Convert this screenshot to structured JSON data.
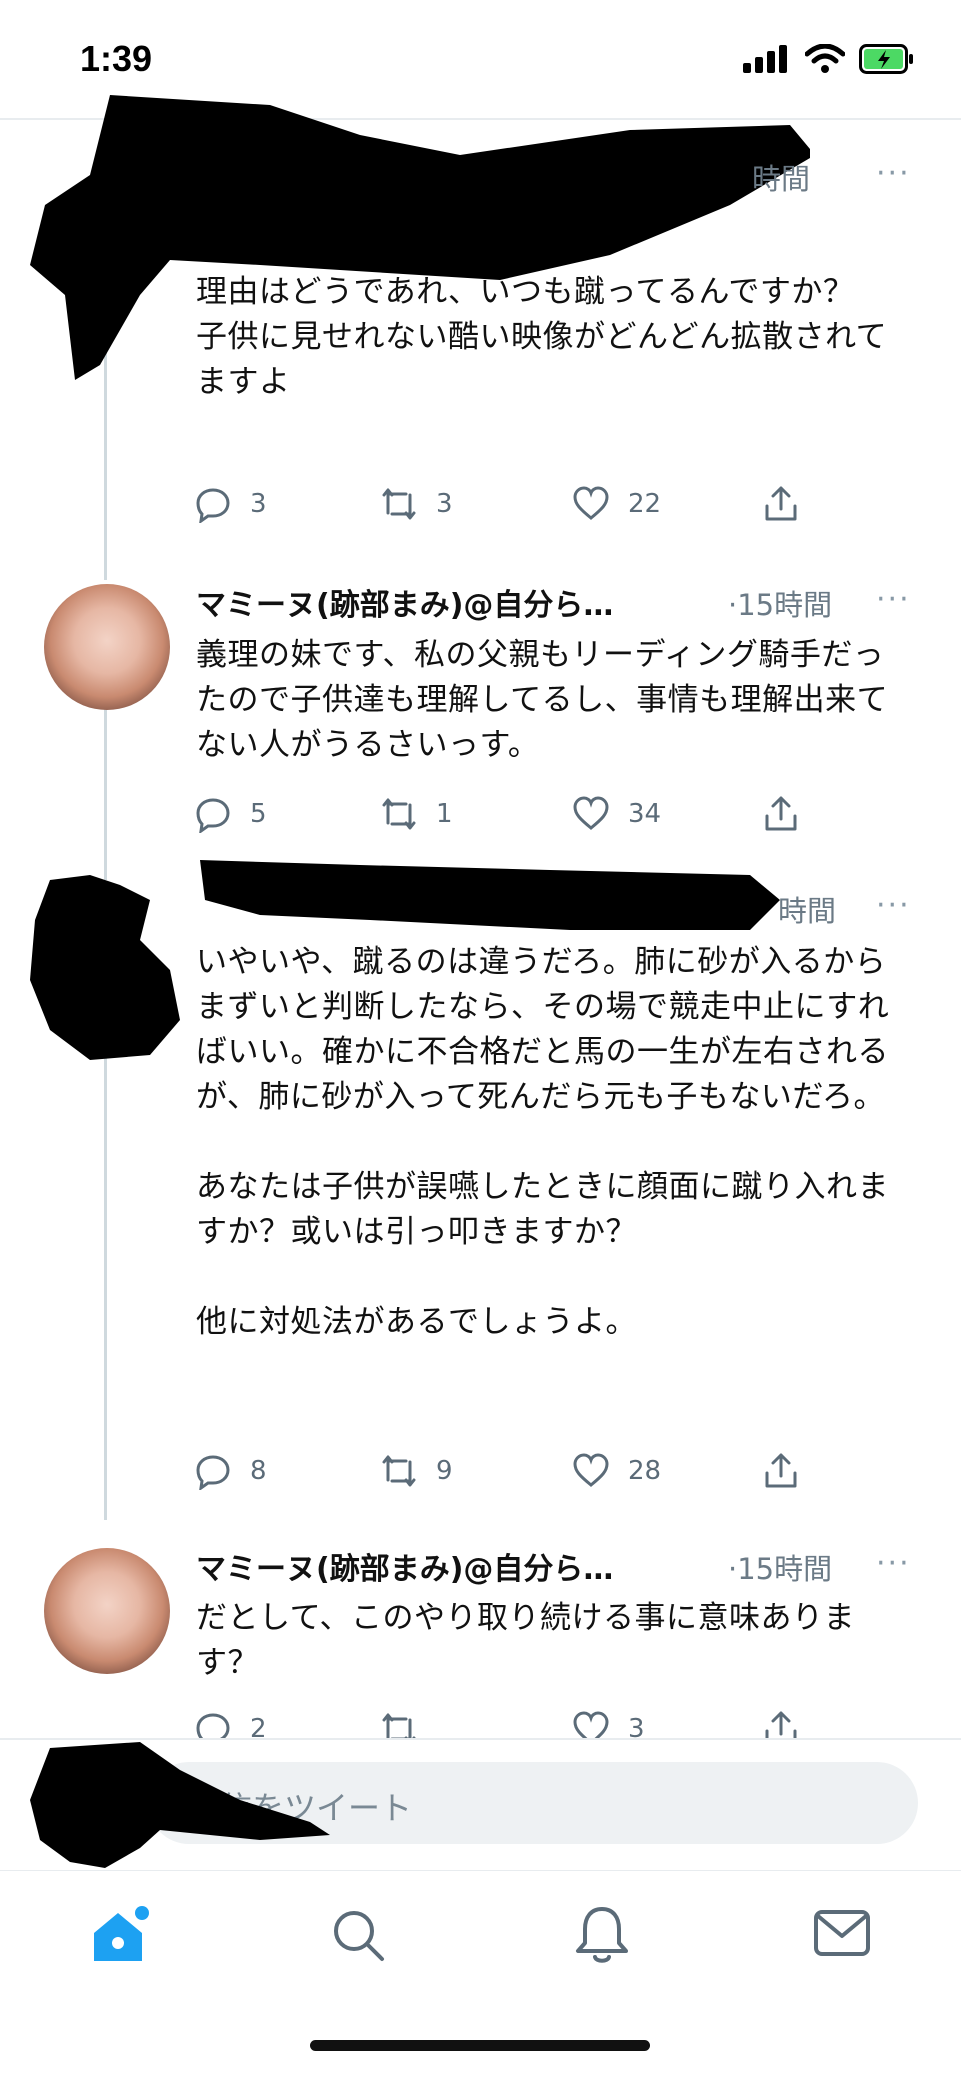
{
  "status_bar": {
    "time": "1:39",
    "icons": [
      "signal-icon",
      "wifi-icon",
      "battery-charging-icon"
    ],
    "battery_color": "#4cd964"
  },
  "tweets": [
    {
      "author": "",
      "time": "時間",
      "text": "理由はどうであれ、いつも蹴ってるんですか？\n子供に見せれない酷い映像がどんどん拡散されてますよ",
      "reply_count": "3",
      "retweet_count": "3",
      "like_count": "22"
    },
    {
      "author": "マミーヌ(跡部まみ)@自分ら…",
      "time": "·15時間",
      "text": "義理の妹です、私の父親もリーディング騎手だったので子供達も理解してるし、事情も理解出来てない人がうるさいっす。",
      "reply_count": "5",
      "retweet_count": "1",
      "like_count": "34"
    },
    {
      "author": "",
      "time": "時間",
      "text": "いやいや、蹴るのは違うだろ。肺に砂が入るからまずいと判断したなら、その場で競走中止にすればいい。確かに不合格だと馬の一生が左右されるが、肺に砂が入って死んだら元も子もないだろ。\n\nあなたは子供が誤嚥したときに顔面に蹴り入れますか？或いは引っ叩きますか？\n\n他に対処法があるでしょうよ。",
      "reply_count": "8",
      "retweet_count": "9",
      "like_count": "28"
    },
    {
      "author": "マミーヌ(跡部まみ)@自分ら…",
      "time": "·15時間",
      "text": "だとして、このやり取り続ける事に意味あります？",
      "reply_count": "2",
      "retweet_count": "",
      "like_count": "3"
    }
  ],
  "more_label": "···",
  "reply_box": {
    "placeholder": "返信をツイート"
  },
  "tab_bar": {
    "items": [
      "home-icon",
      "search-icon",
      "notifications-icon",
      "messages-icon"
    ],
    "active_color": "#1da1f2"
  },
  "accent_color": "#1da1f2"
}
